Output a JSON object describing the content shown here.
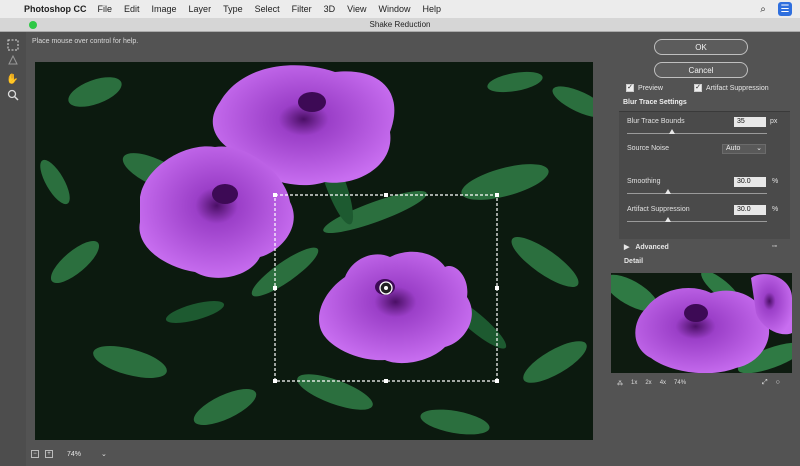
{
  "menubar": {
    "app_name": "Photoshop CC",
    "items": [
      "File",
      "Edit",
      "Image",
      "Layer",
      "Type",
      "Select",
      "Filter",
      "3D",
      "View",
      "Window",
      "Help"
    ]
  },
  "dialog": {
    "title": "Shake Reduction",
    "hint": "Place mouse over control for help."
  },
  "buttons": {
    "ok": "OK",
    "cancel": "Cancel"
  },
  "checkboxes": {
    "preview": {
      "label": "Preview",
      "checked": true
    },
    "artifact_suppression": {
      "label": "Artifact Suppression",
      "checked": true
    }
  },
  "blur_trace": {
    "title": "Blur Trace Settings",
    "bounds": {
      "label": "Blur Trace Bounds",
      "value": "35",
      "unit": "px",
      "level": 0.38
    },
    "source_noise": {
      "label": "Source Noise",
      "value": "Auto"
    },
    "smoothing": {
      "label": "Smoothing",
      "value": "30.0",
      "unit": "%",
      "level": 0.3
    },
    "artifact": {
      "label": "Artifact Suppression",
      "value": "30.0",
      "unit": "%",
      "level": 0.3
    }
  },
  "advanced": {
    "label": "Advanced"
  },
  "detail": {
    "title": "Detail",
    "zoom_options": [
      "1x",
      "2x",
      "4x"
    ],
    "zoom_value": "74%"
  },
  "footer": {
    "zoom": "74%"
  },
  "colors": {
    "petal": "#b65be0",
    "petal_dark": "#6a1f8c",
    "leaf": "#2f7a44",
    "background": "#0c1a0f"
  }
}
